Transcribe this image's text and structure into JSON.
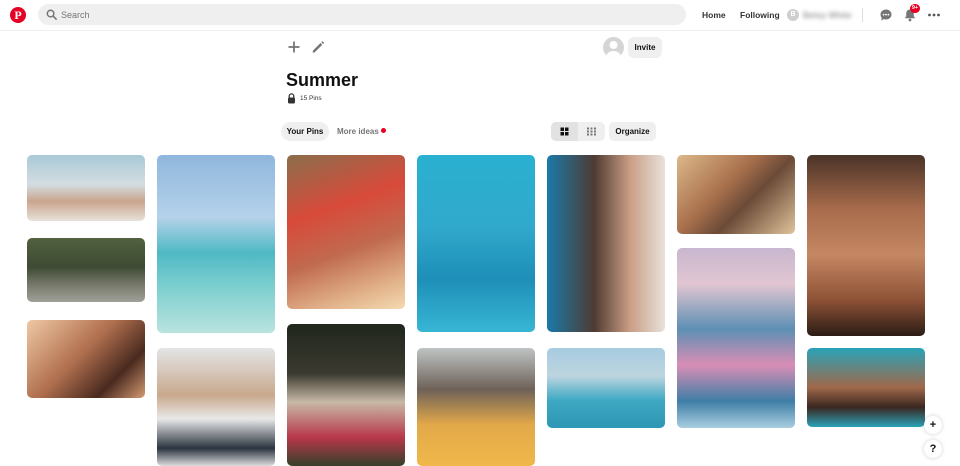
{
  "header": {
    "logo_letter": "P",
    "search": {
      "placeholder": "Search"
    },
    "nav": {
      "home": "Home",
      "following": "Following"
    },
    "user": {
      "initial": "B",
      "name": "Betsy White"
    },
    "notification_count": "9+",
    "icons": [
      "search-icon",
      "chat-icon",
      "bell-icon",
      "more-icon"
    ]
  },
  "board": {
    "toolbar_icons": [
      "plus-icon",
      "pencil-icon"
    ],
    "invite_label": "Invite",
    "title": "Summer",
    "pin_count": "15 Pins",
    "tabs": {
      "your_pins": "Your Pins",
      "more_ideas": "More ideas"
    },
    "organize_label": "Organize"
  },
  "floating": {
    "add": "+",
    "help": "?"
  },
  "colors": {
    "brand": "#e60023",
    "pill": "#efefef"
  }
}
